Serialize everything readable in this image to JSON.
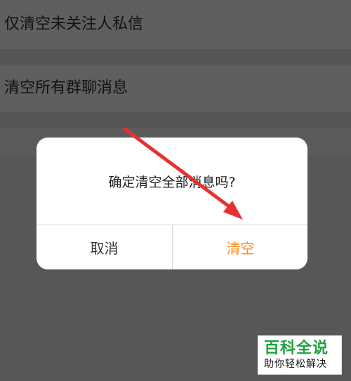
{
  "background_list": {
    "items": [
      {
        "label": "仅清空未关注人私信"
      },
      {
        "label": "清空所有群聊消息"
      }
    ]
  },
  "dialog": {
    "message": "确定清空全部消息吗?",
    "cancel_label": "取消",
    "confirm_label": "清空"
  },
  "watermark": {
    "title": "百科全说",
    "subtitle": "助你轻松解决"
  },
  "colors": {
    "overlay_bg": "#575757",
    "confirm_accent": "#ff8c22",
    "arrow": "#e83030",
    "watermark_green": "#20a33f"
  }
}
